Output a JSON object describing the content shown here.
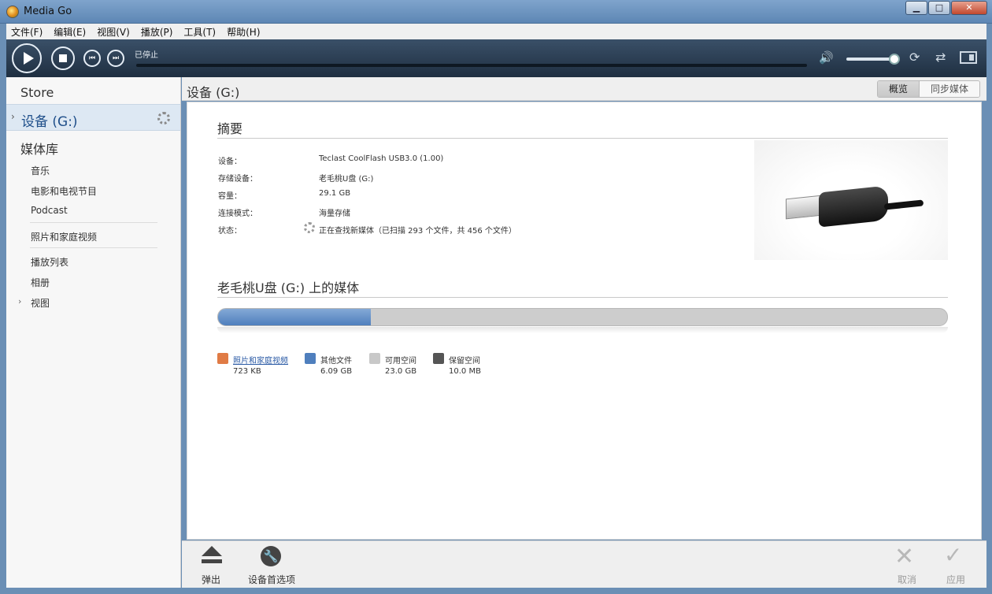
{
  "window": {
    "title": "Media Go",
    "minimize": "▁",
    "maximize": "□",
    "close": "✕"
  },
  "menu": [
    "文件(F)",
    "编辑(E)",
    "视图(V)",
    "播放(P)",
    "工具(T)",
    "帮助(H)"
  ],
  "player": {
    "status": "已停止",
    "prev_glyph": "⏮",
    "next_glyph": "⏭",
    "volume_glyph": "🔊",
    "repeat_glyph": "⟳",
    "shuffle_glyph": "⇄",
    "volume_level": 1.0
  },
  "sidebar": {
    "store": "Store",
    "device": "设备 (G:)",
    "device_arrow": "›",
    "library": "媒体库",
    "items": [
      "音乐",
      "电影和电视节目",
      "Podcast",
      "照片和家庭视频",
      "播放列表",
      "相册",
      "视图"
    ],
    "view_arrow": "›"
  },
  "header": {
    "title": "设备 (G:)",
    "tabs": [
      {
        "label": "概览",
        "active": true
      },
      {
        "label": "同步媒体",
        "active": false
      }
    ]
  },
  "summary": {
    "title": "摘要",
    "rows": [
      {
        "label": "设备：",
        "value": "Teclast CoolFlash USB3.0 (1.00)"
      },
      {
        "label": "存储设备：",
        "value": "老毛桃U盘 (G:)"
      },
      {
        "label": "容量：",
        "value": "29.1 GB"
      },
      {
        "label": "连接模式：",
        "value": "海量存储"
      },
      {
        "label": "状态：",
        "value": "正在查找新媒体（已扫描 293 个文件，共 456 个文件）"
      }
    ]
  },
  "media": {
    "title": "老毛桃U盘 (G:) 上的媒体",
    "used_fraction": 0.21,
    "legend": [
      {
        "label": "照片和家庭视频",
        "size": "723 KB",
        "color": "#e07b45",
        "link": true
      },
      {
        "label": "其他文件",
        "size": "6.09 GB",
        "color": "#4f7fbd",
        "link": false
      },
      {
        "label": "可用空间",
        "size": "23.0 GB",
        "color": "#c8c8c8",
        "link": false
      },
      {
        "label": "保留空间",
        "size": "10.0 MB",
        "color": "#555555",
        "link": false
      }
    ]
  },
  "toolbar": {
    "eject": "弹出",
    "device_prefs": "设备首选项",
    "wrench_glyph": "🔧",
    "cancel": "取消",
    "cancel_glyph": "✕",
    "apply": "应用",
    "apply_glyph": "✓"
  },
  "colors": {
    "accent": "#1f4f8a",
    "bar_fill": "#4f7fbd"
  }
}
